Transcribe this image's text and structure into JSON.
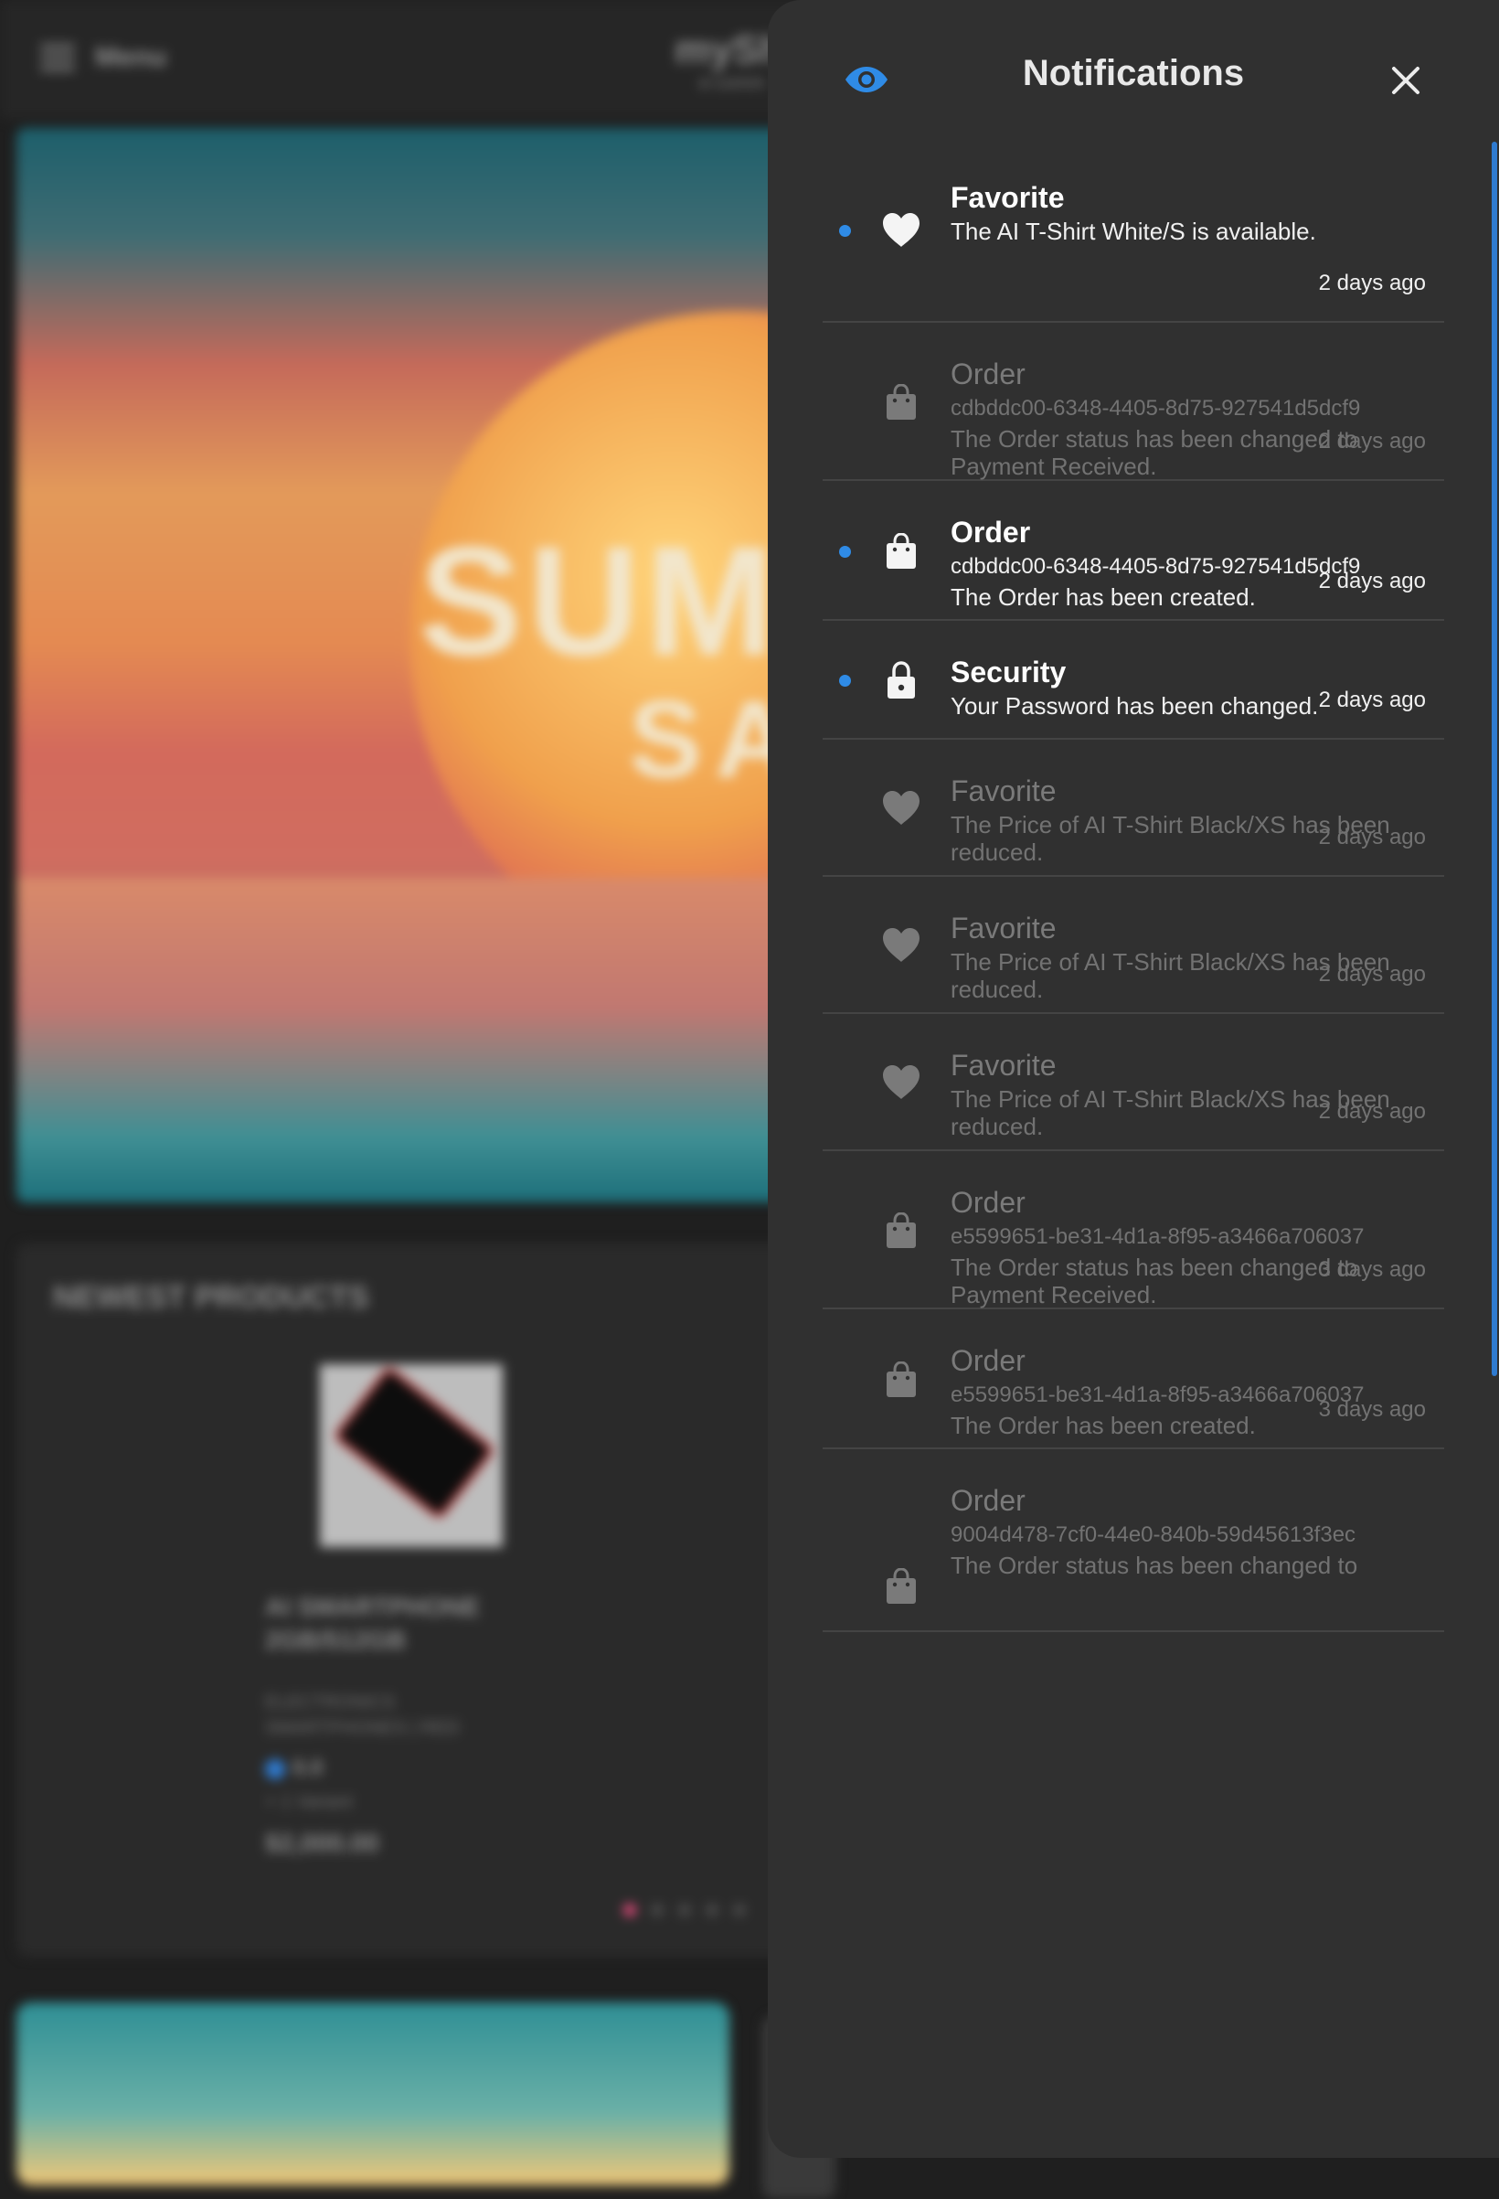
{
  "background": {
    "menu_label": "Menu",
    "brand": "mySh",
    "brand_sub": "e-comm",
    "hero_title_line1": "SUM",
    "hero_title_line2": "SA",
    "products_title": "NEWEST PRODUCTS",
    "product": {
      "name_line1": "AI SMARTPHONE",
      "name_line2": "2GB/512GB",
      "category_line1": "ELECTRONICS",
      "category_line2": "SMARTPHONES | RED",
      "rating": "0.0",
      "variants": "+ 1 Variant",
      "price": "$2,000.00"
    }
  },
  "drawer": {
    "title": "Notifications",
    "accent_color": "#2f8be6",
    "notifications": [
      {
        "type": "Favorite",
        "icon": "heart-icon",
        "unread": true,
        "ref": "",
        "message": "The AI T-Shirt White/S is available.",
        "time": "2 days ago"
      },
      {
        "type": "Order",
        "icon": "shopping-bag-icon",
        "unread": false,
        "ref": "cdbddc00-6348-4405-8d75-927541d5dcf9",
        "message": "The Order status has been changed to Payment Received.",
        "time": "2 days ago"
      },
      {
        "type": "Order",
        "icon": "shopping-bag-icon",
        "unread": true,
        "ref": "cdbddc00-6348-4405-8d75-927541d5dcf9",
        "message": "The Order has been created.",
        "time": "2 days ago"
      },
      {
        "type": "Security",
        "icon": "lock-icon",
        "unread": true,
        "ref": "",
        "message": "Your Password has been changed.",
        "time": "2 days ago"
      },
      {
        "type": "Favorite",
        "icon": "heart-icon",
        "unread": false,
        "ref": "",
        "message": "The Price of AI T-Shirt Black/XS has been reduced.",
        "time": "2 days ago"
      },
      {
        "type": "Favorite",
        "icon": "heart-icon",
        "unread": false,
        "ref": "",
        "message": "The Price of AI T-Shirt Black/XS has been reduced.",
        "time": "2 days ago"
      },
      {
        "type": "Favorite",
        "icon": "heart-icon",
        "unread": false,
        "ref": "",
        "message": "The Price of AI T-Shirt Black/XS has been reduced.",
        "time": "2 days ago"
      },
      {
        "type": "Order",
        "icon": "shopping-bag-icon",
        "unread": false,
        "ref": "e5599651-be31-4d1a-8f95-a3466a706037",
        "message": "The Order status has been changed to Payment Received.",
        "time": "3 days ago"
      },
      {
        "type": "Order",
        "icon": "shopping-bag-icon",
        "unread": false,
        "ref": "e5599651-be31-4d1a-8f95-a3466a706037",
        "message": "The Order has been created.",
        "time": "3 days ago"
      },
      {
        "type": "Order",
        "icon": "shopping-bag-icon",
        "unread": false,
        "ref": "9004d478-7cf0-44e0-840b-59d45613f3ec",
        "message": "The Order status has been changed to",
        "time": ""
      }
    ]
  }
}
